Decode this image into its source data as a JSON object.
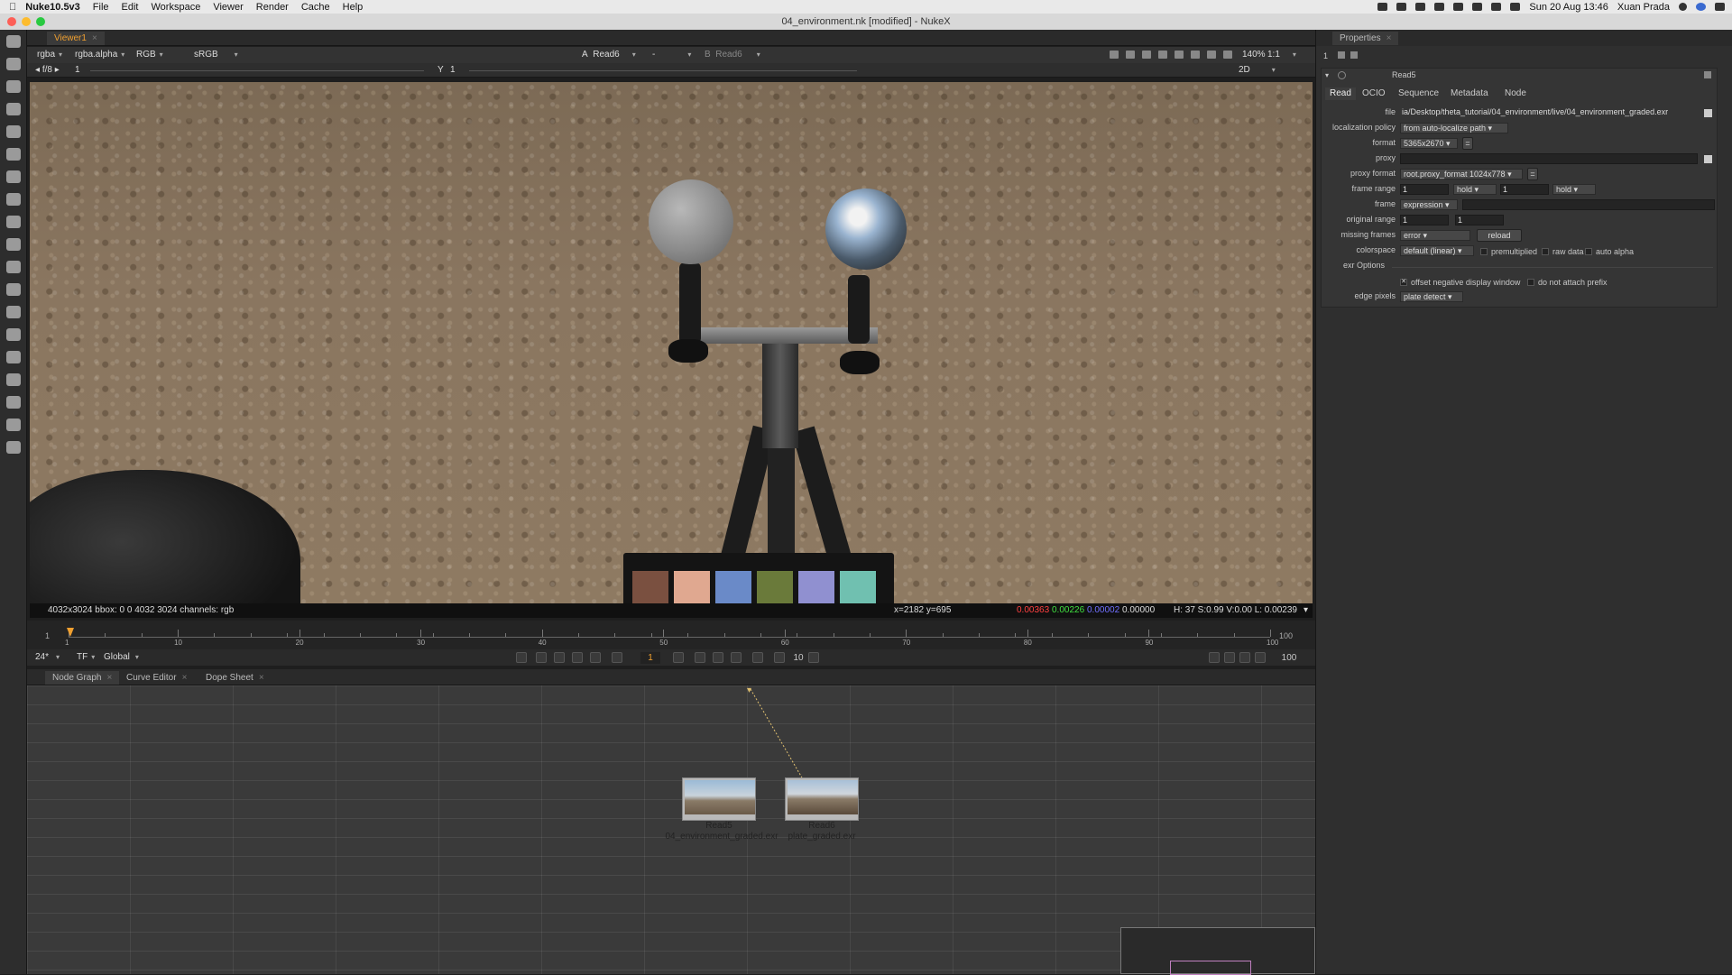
{
  "menubar": {
    "app_name": "Nuke10.5v3",
    "items": [
      "File",
      "Edit",
      "Workspace",
      "Viewer",
      "Render",
      "Cache",
      "Help"
    ],
    "clock": "Sun 20 Aug  13:46",
    "user": "Xuan Prada"
  },
  "window": {
    "title": "04_environment.nk [modified] - NukeX"
  },
  "viewer": {
    "tab_label": "Viewer1",
    "channels": "rgba",
    "alpha": "rgba.alpha",
    "display": "RGB",
    "colorspace": "sRGB",
    "input_a_label": "A",
    "input_a": "Read6",
    "input_op": "-",
    "input_b_label": "B",
    "input_b": "Read6",
    "gain_label": "f/8",
    "gain_value": "1",
    "gamma_label": "Y",
    "gamma_value": "1",
    "zoom": "140%",
    "ratio": "1:1",
    "view_mode": "2D",
    "status_info": "4032x3024  bbox: 0 0 4032 3024 channels: rgb",
    "status_coords": "x=2182 y=695",
    "status_r": "0.00363",
    "status_g": "0.00226",
    "status_b": "0.00002",
    "status_a": "0.00000",
    "status_hsv": "H: 37 S:0.99 V:0.00  L: 0.00239"
  },
  "timeline": {
    "start": "1",
    "end": "100",
    "ticks": [
      "1",
      "10",
      "20",
      "30",
      "40",
      "50",
      "60",
      "70",
      "80",
      "90",
      "100"
    ],
    "fps": "24*",
    "tf": "TF",
    "scope": "Global",
    "current_frame": "1",
    "step": "10",
    "end_field": "100",
    "progress_fraction": 0.0
  },
  "node_graph": {
    "tabs": [
      "Node Graph",
      "Curve Editor",
      "Dope Sheet"
    ],
    "nodes": [
      {
        "name": "Read5",
        "file": "04_environment_graded.exr"
      },
      {
        "name": "Read6",
        "file": "plate_graded.exr"
      }
    ]
  },
  "properties": {
    "panel_title": "Properties",
    "toolbar_count": "1",
    "node_name": "Read5",
    "tabs": [
      "Read",
      "OCIO",
      "Sequence",
      "Metadata",
      "Node"
    ],
    "file_label": "file",
    "file_value": "ia/Desktop/theta_tutorial/04_environment/live/04_environment_graded.exr",
    "localization_label": "localization policy",
    "localization_value": "from auto-localize path",
    "format_label": "format",
    "format_value": "5365x2670",
    "proxy_label": "proxy",
    "proxy_value": "",
    "proxy_format_label": "proxy format",
    "proxy_format_value": "root.proxy_format 1024x778",
    "frame_range_label": "frame range",
    "frame_range_start": "1",
    "frame_range_start_mode": "hold",
    "frame_range_end": "1",
    "frame_range_end_mode": "hold",
    "frame_label": "frame",
    "frame_value": "expression",
    "original_range_label": "original range",
    "original_range_start": "1",
    "original_range_end": "1",
    "missing_frames_label": "missing frames",
    "missing_frames_value": "error",
    "reload_label": "reload",
    "colorspace_label": "colorspace",
    "colorspace_value": "default (linear)",
    "premultiplied_label": "premultiplied",
    "raw_data_label": "raw data",
    "auto_alpha_label": "auto alpha",
    "exr_options_label": "exr Options",
    "offset_negative_label": "offset negative display window",
    "offset_negative_checked": true,
    "no_prefix_label": "do not attach prefix",
    "edge_pixels_label": "edge pixels",
    "edge_pixels_value": "plate detect"
  },
  "colors": {
    "active_tab": "#f0a030",
    "status_r": "#ff4040",
    "status_g": "#40e040",
    "status_b": "#5a5aff"
  }
}
